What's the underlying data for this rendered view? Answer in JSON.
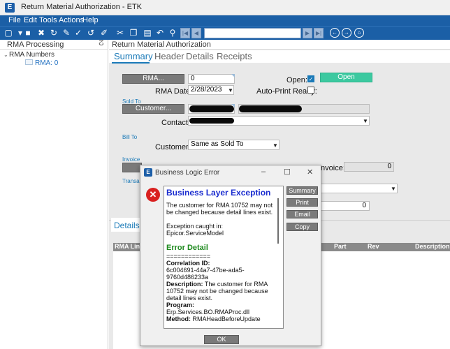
{
  "window": {
    "title": "Return Material Authorization - ETK",
    "app_icon_letter": "E"
  },
  "menu": {
    "file": "File",
    "edit": "Edit",
    "tools": "Tools",
    "actions": "Actions",
    "help": "Help"
  },
  "left_panel": {
    "title": "RMA Processing",
    "pin_icon": "pin-icon",
    "tree_root": "RMA Numbers",
    "tree_child": "RMA: 0"
  },
  "main": {
    "title": "Return Material Authorization",
    "tabs": {
      "summary": "Summary",
      "header": "Header",
      "details": "Details",
      "receipts": "Receipts"
    }
  },
  "form": {
    "rma_button": "RMA...",
    "rma_value": "0",
    "open_label": "Open:",
    "open_button": "Open",
    "rma_date_label": "RMA Date:",
    "rma_date_value": "2/28/2023",
    "auto_print_label": "Auto-Print Ready:",
    "sold_to_group": "Sold To",
    "customer_button": "Customer...",
    "contact_label": "Contact:",
    "bill_to_group": "Bill To",
    "customer_label": "Customer:",
    "customer_value": "Same as Sold To",
    "invoice_group": "Invoice",
    "invoice_label": "Invoice:",
    "invoice_value": "0",
    "transaction_group": "Transac",
    "extra_value": "0"
  },
  "details_area": {
    "tab": "Details",
    "columns": {
      "rma_line": "RMA Line",
      "part": "Part",
      "rev": "Rev",
      "description": "Description"
    }
  },
  "dialog": {
    "title": "Business Logic Error",
    "heading": "Business Layer Exception",
    "message": "The customer for RMA 10752 may not be changed because detail lines exist.",
    "exception_label": "Exception caught in:",
    "exception_source": "Epicor.ServiceModel",
    "error_detail_heading": "Error Detail",
    "separator": "============",
    "correlation_label": "Correlation ID:",
    "correlation_value": "6c004691-44a7-47be-ada5-9760d486233a",
    "description_label": "Description:",
    "description_value": "The customer for RMA 10752 may not be changed because detail lines exist.",
    "program_label": "Program:",
    "program_value": "Erp.Services.BO.RMAProc.dll",
    "method_label": "Method:",
    "method_value": "RMAHeadBeforeUpdate",
    "buttons": {
      "summary": "Summary",
      "print": "Print",
      "email": "Email",
      "copy": "Copy",
      "ok": "OK"
    }
  },
  "colors": {
    "menu_bar": "#1b5fa6",
    "accent_tab": "#1b7ab8",
    "open_button": "#3cc9a0",
    "error_heading": "#1a2ccf",
    "error_detail": "#1f8a1f"
  }
}
